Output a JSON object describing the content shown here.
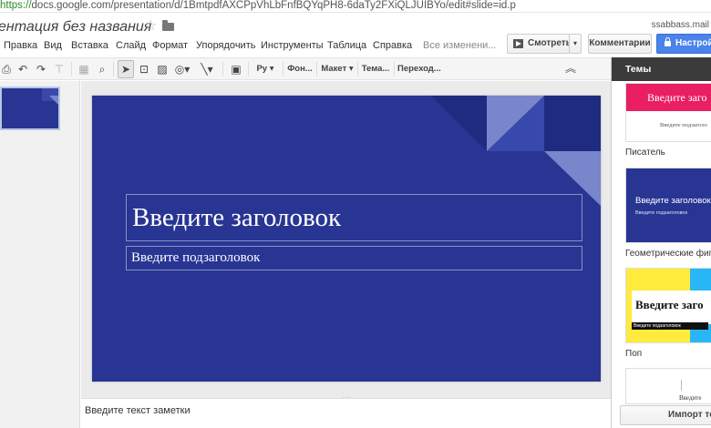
{
  "browser": {
    "url_protocol": "https://",
    "url_rest": "docs.google.com/presentation/d/1BmtpdfAXCPpVhLbFnfBQYqPH8-6daTy2FXiQLJUIBYo/edit#slide=id.p"
  },
  "header": {
    "doc_title": "ентация без названия",
    "user_email": "ssabbass.mail"
  },
  "menu": {
    "items": [
      "Правка",
      "Вид",
      "Вставка",
      "Слайд",
      "Формат",
      "Упорядочить",
      "Инструменты",
      "Таблица",
      "Справка"
    ],
    "save_status": "Все изменени..."
  },
  "actions": {
    "present_label": "Смотреть",
    "present_dropdown": "▾",
    "comments_label": "Комментарии",
    "share_label": "Настройк"
  },
  "toolbar": {
    "font_label": "Ру",
    "background_label": "Фон...",
    "layout_label": "Макет",
    "theme_label": "Тема...",
    "transition_label": "Переход...",
    "collapse_glyph": "︽"
  },
  "slide": {
    "title_placeholder": "Введите заголовок",
    "subtitle_placeholder": "Введите подзаголовок",
    "background_color": "#283593"
  },
  "notes": {
    "placeholder": "Введите текст заметки"
  },
  "themes_panel": {
    "header": "Темы",
    "themes": [
      {
        "name": "",
        "title": "Введите заго",
        "subtitle": "Введите подзаголо"
      },
      {
        "name": "Писатель",
        "title": "Введите заголовок",
        "subtitle": "Введите подзаголовок"
      },
      {
        "name": "Геометрические фиг",
        "title": "Введите заго",
        "subtitle": "Введите подзаголовок"
      },
      {
        "name": "Поп",
        "title": "Введите"
      }
    ],
    "import_label": "Импорт те"
  }
}
